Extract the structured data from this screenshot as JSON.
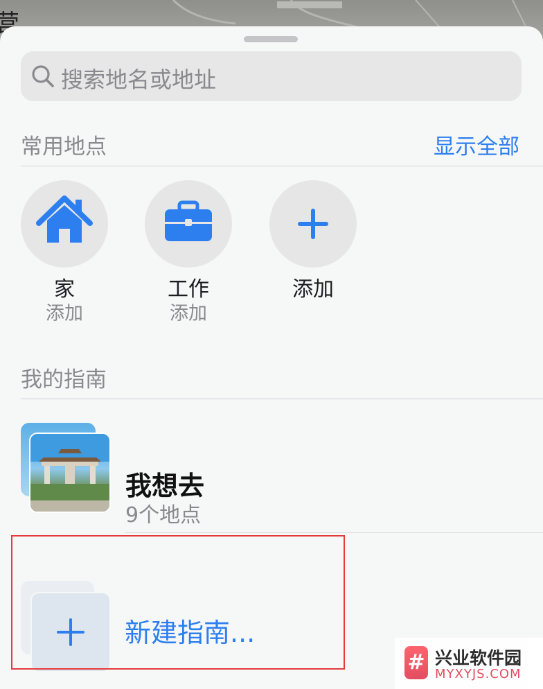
{
  "map": {
    "partial_label": "营"
  },
  "search": {
    "placeholder": "搜索地名或地址",
    "icon": "magnifier-icon"
  },
  "favorites": {
    "title": "常用地点",
    "show_all": "显示全部",
    "items": [
      {
        "name": "家",
        "sub": "添加",
        "icon": "home-icon"
      },
      {
        "name": "工作",
        "sub": "添加",
        "icon": "briefcase-icon"
      },
      {
        "name": "添加",
        "sub": "",
        "icon": "plus-icon"
      }
    ]
  },
  "guides": {
    "title": "我的指南",
    "items": [
      {
        "name": "我想去",
        "count": "9个地点"
      }
    ],
    "new_guide": "新建指南..."
  },
  "watermark": {
    "cn": "兴业软件园",
    "en": "MYXYJS.COM",
    "logo_glyph": "#"
  },
  "colors": {
    "accent": "#2d7ff0",
    "highlight": "#e53b3b",
    "sheet_bg": "#f6f7f7"
  }
}
